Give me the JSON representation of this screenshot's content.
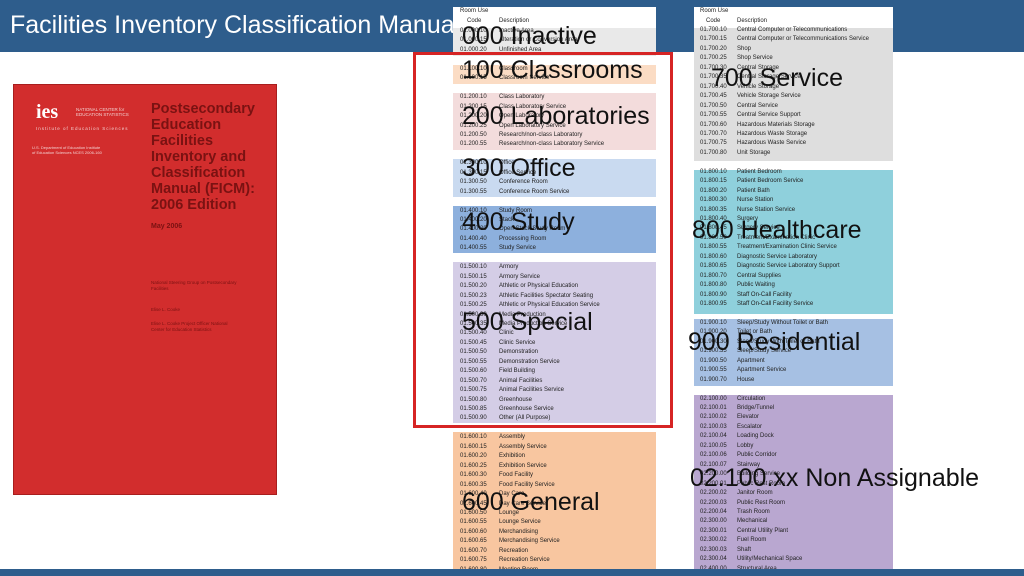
{
  "header": {
    "title": "Facilities Inventory Classification Manual"
  },
  "cover": {
    "logo_text": "ies",
    "org_name": "NATIONAL CENTER for EDUCATION STATISTICS",
    "institute": "Institute of Education Sciences",
    "left_small": "U.S. Department of Education Institute of Education Sciences NCES 2006-160",
    "heading": "Postsecondary Education Facilities Inventory and Classification Manual (FICM): 2006 Edition",
    "date": "May 2006",
    "small1": "National Steering Group on Postsecondary Facilities",
    "small2": "Elise L. Cooke",
    "small3": "Elise L. Cooke Project Officer National Center for Education Statistics"
  },
  "table_left": {
    "header_line1": "Room Use",
    "header_code": "Code",
    "header_desc": "Description",
    "rows": [
      {
        "code": "01.000.10",
        "desc": "Inactive Area"
      },
      {
        "code": "01.000.15",
        "desc": "Alteration or Conversion Area"
      },
      {
        "code": "01.000.20",
        "desc": "Unfinished Area"
      },
      {
        "code": "",
        "desc": ""
      },
      {
        "code": "01.100.10",
        "desc": "Classroom"
      },
      {
        "code": "01.100.15",
        "desc": "Classroom Service"
      },
      {
        "code": "",
        "desc": ""
      },
      {
        "code": "01.200.10",
        "desc": "Class Laboratory"
      },
      {
        "code": "01.200.15",
        "desc": "Class Laboratory Service"
      },
      {
        "code": "01.200.20",
        "desc": "Open Laboratory"
      },
      {
        "code": "01.200.25",
        "desc": "Open Laboratory Service"
      },
      {
        "code": "01.200.50",
        "desc": "Research/non-class Laboratory"
      },
      {
        "code": "01.200.55",
        "desc": "Research/non-class Laboratory Service"
      },
      {
        "code": "",
        "desc": ""
      },
      {
        "code": "01.300.10",
        "desc": "Office"
      },
      {
        "code": "01.300.15",
        "desc": "Office Service"
      },
      {
        "code": "01.300.50",
        "desc": "Conference Room"
      },
      {
        "code": "01.300.55",
        "desc": "Conference Room Service"
      },
      {
        "code": "",
        "desc": ""
      },
      {
        "code": "01.400.10",
        "desc": "Study Room"
      },
      {
        "code": "01.400.20",
        "desc": "Stack"
      },
      {
        "code": "01.400.30",
        "desc": "Open-Stack Study Room"
      },
      {
        "code": "01.400.40",
        "desc": "Processing Room"
      },
      {
        "code": "01.400.55",
        "desc": "Study Service"
      },
      {
        "code": "",
        "desc": ""
      },
      {
        "code": "01.500.10",
        "desc": "Armory"
      },
      {
        "code": "01.500.15",
        "desc": "Armory Service"
      },
      {
        "code": "01.500.20",
        "desc": "Athletic or Physical Education"
      },
      {
        "code": "01.500.23",
        "desc": "Athletic Facilities Spectator Seating"
      },
      {
        "code": "01.500.25",
        "desc": "Athletic or Physical Education Service"
      },
      {
        "code": "01.500.30",
        "desc": "Media Production"
      },
      {
        "code": "01.500.35",
        "desc": "Media Production Service"
      },
      {
        "code": "01.500.40",
        "desc": "Clinic"
      },
      {
        "code": "01.500.45",
        "desc": "Clinic Service"
      },
      {
        "code": "01.500.50",
        "desc": "Demonstration"
      },
      {
        "code": "01.500.55",
        "desc": "Demonstration Service"
      },
      {
        "code": "01.500.60",
        "desc": "Field Building"
      },
      {
        "code": "01.500.70",
        "desc": "Animal Facilities"
      },
      {
        "code": "01.500.75",
        "desc": "Animal Facilities Service"
      },
      {
        "code": "01.500.80",
        "desc": "Greenhouse"
      },
      {
        "code": "01.500.85",
        "desc": "Greenhouse Service"
      },
      {
        "code": "01.500.90",
        "desc": "Other (All Purpose)"
      },
      {
        "code": "",
        "desc": ""
      },
      {
        "code": "01.600.10",
        "desc": "Assembly"
      },
      {
        "code": "01.600.15",
        "desc": "Assembly Service"
      },
      {
        "code": "01.600.20",
        "desc": "Exhibition"
      },
      {
        "code": "01.600.25",
        "desc": "Exhibition Service"
      },
      {
        "code": "01.600.30",
        "desc": "Food Facility"
      },
      {
        "code": "01.600.35",
        "desc": "Food Facility Service"
      },
      {
        "code": "01.600.40",
        "desc": "Day Care"
      },
      {
        "code": "01.600.45",
        "desc": "Day Care Service"
      },
      {
        "code": "01.600.50",
        "desc": "Lounge"
      },
      {
        "code": "01.600.55",
        "desc": "Lounge Service"
      },
      {
        "code": "01.600.60",
        "desc": "Merchandising"
      },
      {
        "code": "01.600.65",
        "desc": "Merchandising Service"
      },
      {
        "code": "01.600.70",
        "desc": "Recreation"
      },
      {
        "code": "01.600.75",
        "desc": "Recreation Service"
      },
      {
        "code": "01.600.80",
        "desc": "Meeting Room"
      }
    ]
  },
  "table_right": {
    "header_line1": "Room Use",
    "header_code": "Code",
    "header_desc": "Description",
    "rows": [
      {
        "code": "01.700.10",
        "desc": "Central Computer or Telecommunications"
      },
      {
        "code": "01.700.15",
        "desc": "Central Computer or Telecommunications Service"
      },
      {
        "code": "01.700.20",
        "desc": "Shop"
      },
      {
        "code": "01.700.25",
        "desc": "Shop Service"
      },
      {
        "code": "01.700.30",
        "desc": "Central Storage"
      },
      {
        "code": "01.700.35",
        "desc": "Central Storage Service"
      },
      {
        "code": "01.700.40",
        "desc": "Vehicle Storage"
      },
      {
        "code": "01.700.45",
        "desc": "Vehicle Storage Service"
      },
      {
        "code": "01.700.50",
        "desc": "Central Service"
      },
      {
        "code": "01.700.55",
        "desc": "Central Service Support"
      },
      {
        "code": "01.700.60",
        "desc": "Hazardous Materials Storage"
      },
      {
        "code": "01.700.70",
        "desc": "Hazardous Waste Storage"
      },
      {
        "code": "01.700.75",
        "desc": "Hazardous Waste Service"
      },
      {
        "code": "01.700.80",
        "desc": "Unit Storage"
      },
      {
        "code": "",
        "desc": ""
      },
      {
        "code": "01.800.10",
        "desc": "Patient Bedroom"
      },
      {
        "code": "01.800.15",
        "desc": "Patient Bedroom Service"
      },
      {
        "code": "01.800.20",
        "desc": "Patient Bath"
      },
      {
        "code": "01.800.30",
        "desc": "Nurse Station"
      },
      {
        "code": "01.800.35",
        "desc": "Nurse Station Service"
      },
      {
        "code": "01.800.40",
        "desc": "Surgery"
      },
      {
        "code": "01.800.45",
        "desc": "Surgery Service"
      },
      {
        "code": "01.800.50",
        "desc": "Treatment/Examination Clinic"
      },
      {
        "code": "01.800.55",
        "desc": "Treatment/Examination Clinic Service"
      },
      {
        "code": "01.800.60",
        "desc": "Diagnostic Service Laboratory"
      },
      {
        "code": "01.800.65",
        "desc": "Diagnostic Service Laboratory Support"
      },
      {
        "code": "01.800.70",
        "desc": "Central Supplies"
      },
      {
        "code": "01.800.80",
        "desc": "Public Waiting"
      },
      {
        "code": "01.800.90",
        "desc": "Staff On-Call Facility"
      },
      {
        "code": "01.800.95",
        "desc": "Staff On-Call Facility Service"
      },
      {
        "code": "",
        "desc": ""
      },
      {
        "code": "01.900.10",
        "desc": "Sleep/Study Without Toilet or Bath"
      },
      {
        "code": "01.900.20",
        "desc": "Toilet or Bath"
      },
      {
        "code": "01.900.30",
        "desc": "Sleep/Study With Toilet or Bath"
      },
      {
        "code": "01.900.35",
        "desc": "Sleep/Study Service"
      },
      {
        "code": "01.900.50",
        "desc": "Apartment"
      },
      {
        "code": "01.900.55",
        "desc": "Apartment Service"
      },
      {
        "code": "01.900.70",
        "desc": "House"
      },
      {
        "code": "",
        "desc": ""
      },
      {
        "code": "02.100.00",
        "desc": "Circulation"
      },
      {
        "code": "02.100.01",
        "desc": "Bridge/Tunnel"
      },
      {
        "code": "02.100.02",
        "desc": "Elevator"
      },
      {
        "code": "02.100.03",
        "desc": "Escalator"
      },
      {
        "code": "02.100.04",
        "desc": "Loading Dock"
      },
      {
        "code": "02.100.05",
        "desc": "Lobby"
      },
      {
        "code": "02.100.06",
        "desc": "Public Corridor"
      },
      {
        "code": "02.100.07",
        "desc": "Stairway"
      },
      {
        "code": "02.200.00",
        "desc": "Building Service"
      },
      {
        "code": "02.200.01",
        "desc": "Public Rest Room"
      },
      {
        "code": "02.200.02",
        "desc": "Janitor Room"
      },
      {
        "code": "02.200.03",
        "desc": "Public Rest Room"
      },
      {
        "code": "02.200.04",
        "desc": "Trash Room"
      },
      {
        "code": "02.300.00",
        "desc": "Mechanical"
      },
      {
        "code": "02.300.01",
        "desc": "Central Utility Plant"
      },
      {
        "code": "02.300.02",
        "desc": "Fuel Room"
      },
      {
        "code": "02.300.03",
        "desc": "Shaft"
      },
      {
        "code": "02.300.04",
        "desc": "Utility/Mechanical Space"
      },
      {
        "code": "02.400.00",
        "desc": "Structural Area"
      }
    ]
  },
  "overlays": {
    "inactive": "000 Inactive",
    "classrooms": "100 Classrooms",
    "laboratories": "200 Laboratories",
    "office": "300 Office",
    "study": "400 Study",
    "special": "500 Special",
    "general": "600 General",
    "service": "700 Service",
    "healthcare": "800 Healthcare",
    "residential": "900 Residential",
    "nonassignable": "02.100.xx Non Assignable"
  },
  "colors": {
    "title_bar": "#2e5d8c",
    "cover_red": "#d22d2d",
    "highlight_box": "#d62424",
    "band_000": "#e9e9e9",
    "band_100": "#fbdcc4",
    "band_200": "#f3dcdc",
    "band_300": "#c9daf0",
    "band_400": "#8db0dd",
    "band_500": "#d4cde6",
    "band_600": "#f8c6a0",
    "band_700": "#dedede",
    "band_800": "#8fd0dc",
    "band_900": "#a6c0e3",
    "band_nonassign": "#b9a7d0"
  }
}
